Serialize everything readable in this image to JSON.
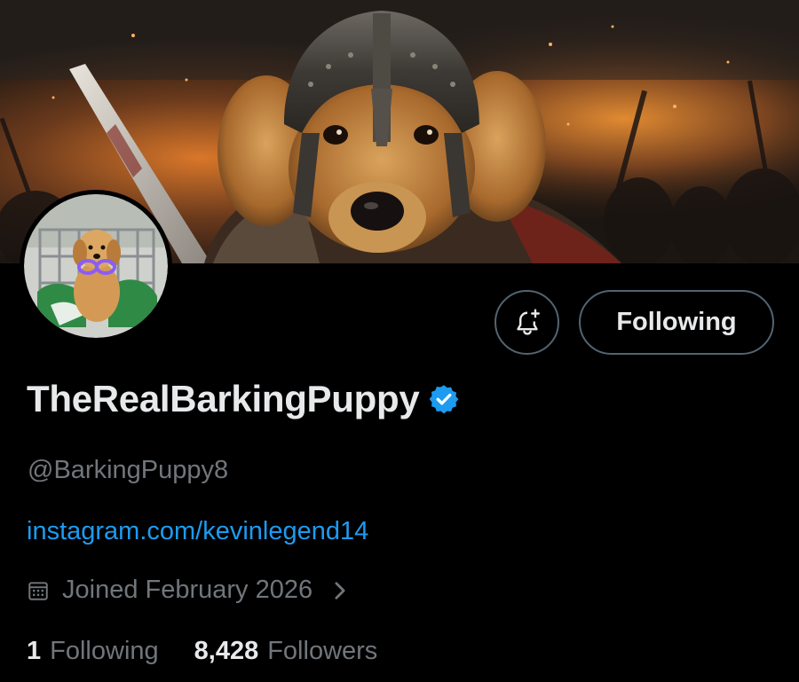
{
  "profile": {
    "display_name": "TheRealBarkingPuppy",
    "verified": true,
    "handle": "@BarkingPuppy8",
    "website": "instagram.com/kevinlegend14",
    "joined": "Joined February 2026",
    "banner_image": "warrior-dog-helmet-banner",
    "avatar_image": "puppy-in-shopping-cart-avatar"
  },
  "actions": {
    "notify_icon": "bell-plus-icon",
    "follow_label": "Following"
  },
  "stats": {
    "following_count": "1",
    "following_label": "Following",
    "followers_count": "8,428",
    "followers_label": "Followers"
  },
  "colors": {
    "background": "#000000",
    "primary_text": "#e7e9ea",
    "secondary_text": "#71767b",
    "link": "#1d9bf0",
    "verified_badge": "#1d9bf0",
    "button_border": "#536471"
  }
}
